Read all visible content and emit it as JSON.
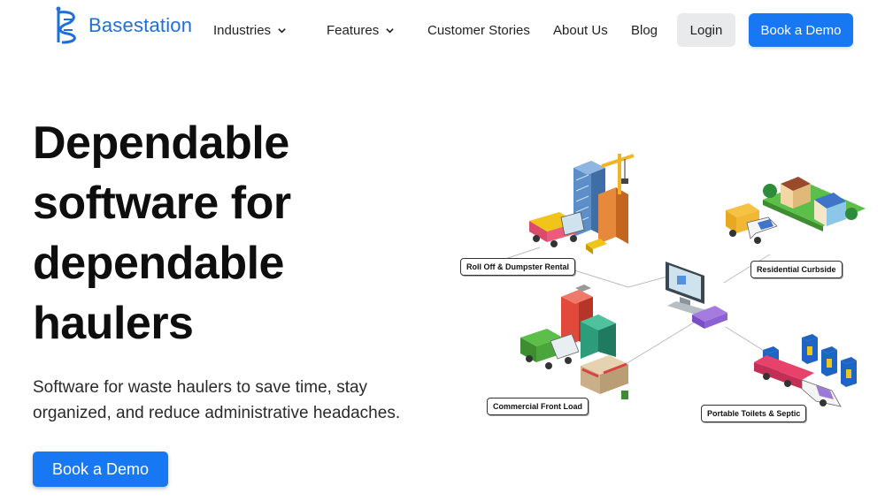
{
  "brand": {
    "name": "Basestation",
    "color": "#1e6fd9"
  },
  "nav": {
    "items": [
      {
        "label": "Industries",
        "has_dropdown": true
      },
      {
        "label": "Features",
        "has_dropdown": true
      },
      {
        "label": "Customer Stories",
        "has_dropdown": false
      },
      {
        "label": "About Us",
        "has_dropdown": false
      },
      {
        "label": "Blog",
        "has_dropdown": false
      }
    ],
    "login_label": "Login",
    "demo_label": "Book a Demo"
  },
  "hero": {
    "title_lines": [
      "Dependable",
      "software for",
      "dependable",
      "haulers"
    ],
    "subtitle": "Software for waste haulers to save time, stay organized, and reduce administrative headaches.",
    "cta_label": "Book a Demo"
  },
  "illustration": {
    "tags": [
      {
        "label": "Roll Off & Dumpster Rental"
      },
      {
        "label": "Residential Curbside"
      },
      {
        "label": "Commercial Front Load"
      },
      {
        "label": "Portable Toilets & Septic"
      }
    ]
  },
  "colors": {
    "accent": "#1877f2",
    "login_bg": "#e9eaec"
  }
}
